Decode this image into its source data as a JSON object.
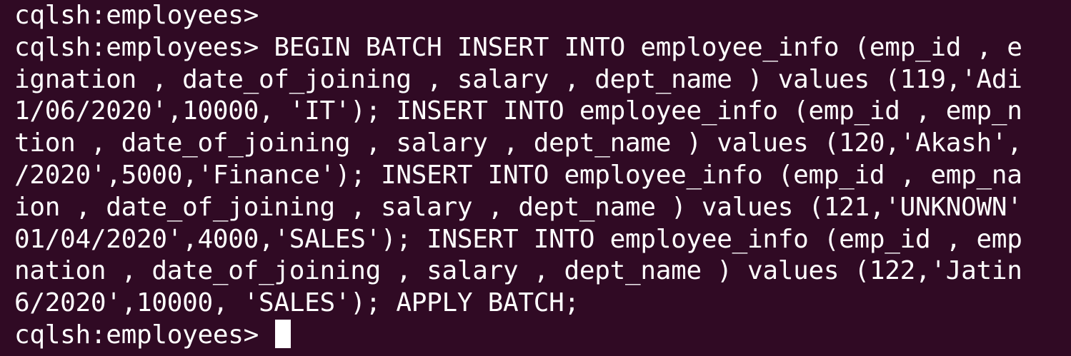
{
  "terminal": {
    "lines": [
      "cqlsh:employees>",
      "cqlsh:employees> BEGIN BATCH INSERT INTO employee_info (emp_id , e",
      "ignation , date_of_joining , salary , dept_name ) values (119,'Adi",
      "1/06/2020',10000, 'IT'); INSERT INTO employee_info (emp_id , emp_n",
      "tion , date_of_joining , salary , dept_name ) values (120,'Akash',",
      "/2020',5000,'Finance'); INSERT INTO employee_info (emp_id , emp_na",
      "ion , date_of_joining , salary , dept_name ) values (121,'UNKNOWN'",
      "01/04/2020',4000,'SALES'); INSERT INTO employee_info (emp_id , emp",
      "nation , date_of_joining , salary , dept_name ) values (122,'Jatin",
      "6/2020',10000, 'SALES'); APPLY BATCH;"
    ],
    "prompt": "cqlsh:employees> "
  },
  "colors": {
    "background": "#300a24",
    "text": "#ffffff",
    "cursor": "#ffffff"
  }
}
